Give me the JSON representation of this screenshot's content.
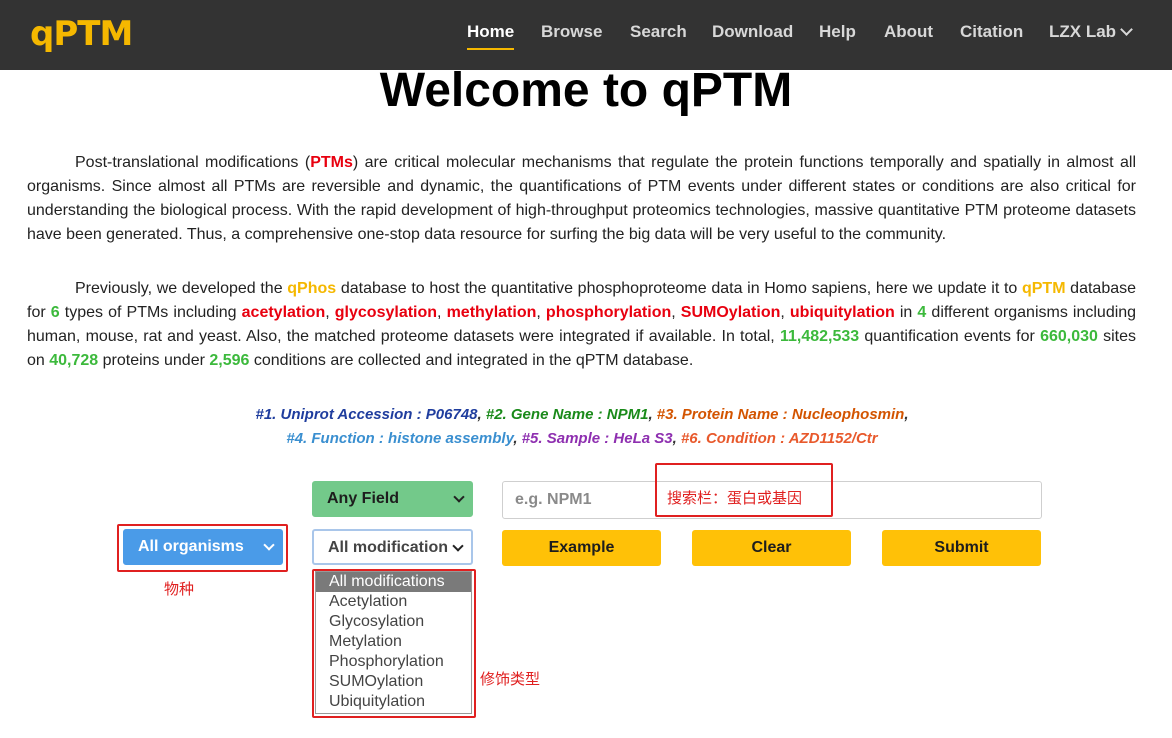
{
  "brand": {
    "logo": "qPTM"
  },
  "nav": {
    "items": [
      "Home",
      "Browse",
      "Search",
      "Download",
      "Help",
      "About",
      "Citation"
    ],
    "dropdown_label": "LZX Lab",
    "active": "Home"
  },
  "welcome_title": "Welcome to qPTM",
  "intro": {
    "p1_before": "Post-translational modifications (",
    "p1_ptms": "PTMs",
    "p1_after": ") are critical molecular mechanisms that regulate the protein functions temporally and spatially in almost all organisms. Since almost all PTMs are reversible and dynamic, the quantifications of PTM events under different states or conditions are also critical for understanding the biological process. With the rapid development of high-throughput proteomics technologies, massive quantitative PTM proteome datasets have been generated. Thus, a comprehensive one-stop data resource for surfing the big data will be very useful to the community.",
    "p2": {
      "t1": "Previously, we developed the ",
      "qphos": "qPhos",
      "t2": " database to host the quantitative phosphoproteome data in Homo sapiens, here we update it to ",
      "qptm": "qPTM",
      "t3": " database for ",
      "n_types": "6",
      "t4": " types of PTMs including ",
      "ptm1": "acetylation",
      "ptm2": "glycosylation",
      "ptm3": "methylation",
      "ptm4": "phosphorylation",
      "ptm5": "SUMOylation",
      "ptm6": "ubiquitylation",
      "comma": ", ",
      "t5": " in ",
      "n_orgs": "4",
      "t6": " different organisms including human, mouse, rat and yeast. Also, the matched proteome datasets were integrated if available. In total, ",
      "n_events": "11,482,533",
      "t7": " quantification events for ",
      "n_sites": "660,030",
      "t8": " sites on ",
      "n_proteins": "40,728",
      "t9": " proteins under ",
      "n_conditions": "2,596",
      "t10": " conditions are collected and integrated in the qPTM database."
    }
  },
  "examples": {
    "e1": "#1. Uniprot Accession : P06748",
    "e2": "#2. Gene Name : NPM1",
    "e3": "#3. Protein Name : Nucleophosmin",
    "e4": "#4. Function : histone assembly",
    "e5": "#5. Sample : HeLa S3",
    "e6": "#6. Condition : AZD1152/Ctr",
    "comma": ", ",
    "trail": ","
  },
  "search": {
    "field_select": "Any Field",
    "organism_select": "All organisms",
    "modification_select": "All modification",
    "input_placeholder": "e.g. NPM1",
    "example_button": "Example",
    "clear_button": "Clear",
    "submit_button": "Submit",
    "modification_options": [
      "All modifications",
      "Acetylation",
      "Glycosylation",
      "Metylation",
      "Phosphorylation",
      "SUMOylation",
      "Ubiquitylation"
    ]
  },
  "annotations": {
    "search_bar": "搜索栏：蛋白或基因",
    "organism": "物种",
    "modification_type": "修饰类型"
  },
  "colors": {
    "navbar": "#333333",
    "accent_gold": "#f5b800",
    "ptm_red": "#e8000f",
    "count_green": "#3cb93c",
    "organism_blue": "#4a9be8",
    "field_green": "#73c98a",
    "button_yellow": "#ffc107",
    "annotation_red": "#e02020"
  }
}
